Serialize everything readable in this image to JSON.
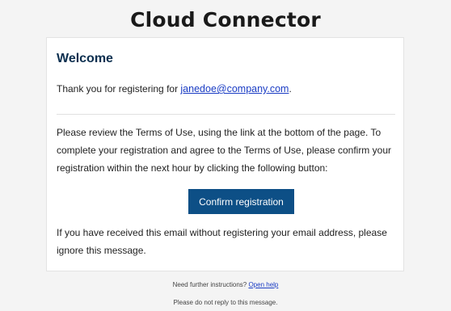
{
  "header": {
    "title": "Cloud Connector"
  },
  "email": {
    "heading": "Welcome",
    "thanks_prefix": "Thank you for registering for ",
    "registered_email": "janedoe@company.com",
    "thanks_suffix": ".",
    "instructions": "Please review the Terms of Use, using the link at the bottom of the page. To complete your registration and agree to the Terms of Use, please confirm your registration within the next hour by clicking the following button:",
    "confirm_button_label": "Confirm registration",
    "ignore_notice": "If you have received this email without registering your email address, please ignore this message."
  },
  "footer": {
    "help_prefix": "Need further instructions? ",
    "help_link": "Open help",
    "no_reply": "Please do not reply to this message."
  },
  "colors": {
    "button_background": "#0d4f86",
    "heading": "#0c2f4f",
    "link": "#1a3cc4",
    "page_background": "#f4f4f4"
  }
}
